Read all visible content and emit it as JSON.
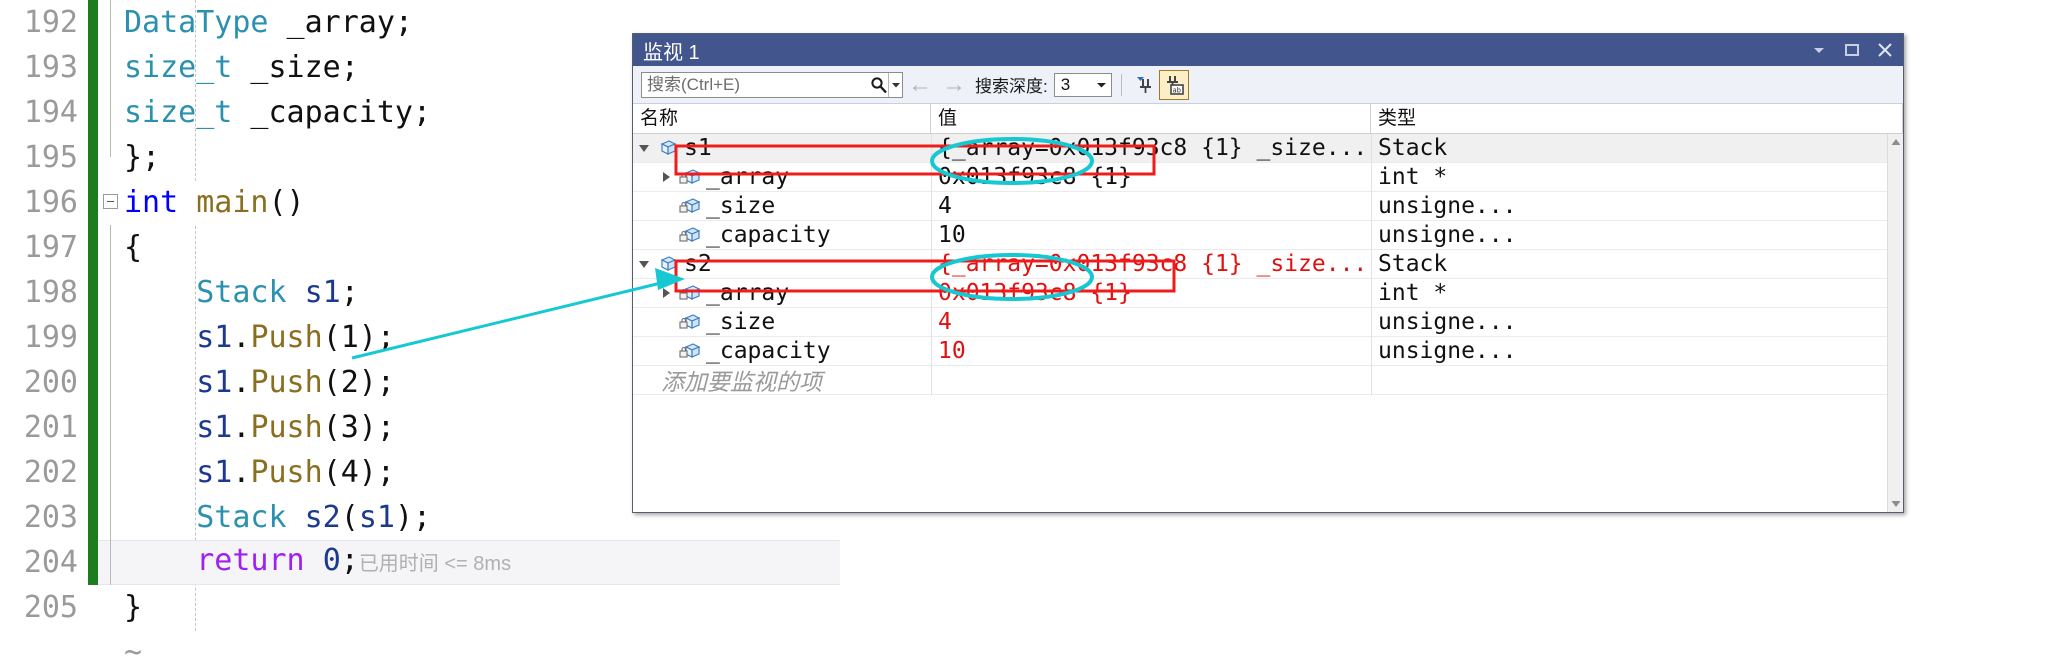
{
  "editor": {
    "elapsed_annotation": "已用时间 <= 8ms",
    "tilde": "~",
    "lines": [
      {
        "num": "192",
        "text": "DataType _array;"
      },
      {
        "num": "193",
        "text": "size_t _size;"
      },
      {
        "num": "194",
        "text": "size_t _capacity;"
      },
      {
        "num": "195",
        "text": "};"
      },
      {
        "num": "196",
        "text": "int main()"
      },
      {
        "num": "197",
        "text": "{"
      },
      {
        "num": "198",
        "text": "Stack s1;"
      },
      {
        "num": "199",
        "text": "s1.Push(1);"
      },
      {
        "num": "200",
        "text": "s1.Push(2);"
      },
      {
        "num": "201",
        "text": "s1.Push(3);"
      },
      {
        "num": "202",
        "text": "s1.Push(4);"
      },
      {
        "num": "203",
        "text": "Stack s2(s1);"
      },
      {
        "num": "204",
        "text": "return 0;"
      },
      {
        "num": "205",
        "text": "}"
      }
    ]
  },
  "watch": {
    "title": "监视 1",
    "titlebar_buttons": [
      "chevron-down-icon",
      "maximize-icon",
      "close-icon"
    ],
    "toolbar": {
      "search_placeholder": "搜索(Ctrl+E)",
      "search_value": "",
      "back_arrow": "←",
      "forward_arrow": "→",
      "depth_label": "搜索深度:",
      "depth_value": "3"
    },
    "columns": {
      "name": "名称",
      "value": "值",
      "type": "类型"
    },
    "add_watch_placeholder": "添加要监视的项",
    "rows": [
      {
        "name": "s1",
        "value": "{_array=0x013f93c8 {1} _size...",
        "type": "Stack",
        "level": 0,
        "expander": "down",
        "selected": true,
        "changed": false,
        "icon": "struct-icon"
      },
      {
        "name": "_array",
        "value": "0x013f93c8 {1}",
        "type": "int *",
        "level": 1,
        "expander": "right",
        "selected": false,
        "changed": false,
        "icon": "field-lock-icon"
      },
      {
        "name": "_size",
        "value": "4",
        "type": "unsigne...",
        "level": 1,
        "expander": "none",
        "selected": false,
        "changed": false,
        "icon": "field-lock-icon"
      },
      {
        "name": "_capacity",
        "value": "10",
        "type": "unsigne...",
        "level": 1,
        "expander": "none",
        "selected": false,
        "changed": false,
        "icon": "field-lock-icon"
      },
      {
        "name": "s2",
        "value": "{_array=0x013f93c8 {1} _size...",
        "type": "Stack",
        "level": 0,
        "expander": "down",
        "selected": false,
        "changed": true,
        "icon": "struct-icon"
      },
      {
        "name": "_array",
        "value": "0x013f93c8 {1}",
        "type": "int *",
        "level": 1,
        "expander": "right",
        "selected": false,
        "changed": true,
        "icon": "field-lock-icon"
      },
      {
        "name": "_size",
        "value": "4",
        "type": "unsigne...",
        "level": 1,
        "expander": "none",
        "selected": false,
        "changed": true,
        "icon": "field-lock-icon"
      },
      {
        "name": "_capacity",
        "value": "10",
        "type": "unsigne...",
        "level": 1,
        "expander": "none",
        "selected": false,
        "changed": true,
        "icon": "field-lock-icon"
      }
    ]
  },
  "annotations": {
    "highlight_color": "#f01b1b",
    "ellipse_color": "#16c8d2",
    "red_boxes": 2,
    "cyan_ellipses": 2,
    "cyan_arrow": 1
  }
}
